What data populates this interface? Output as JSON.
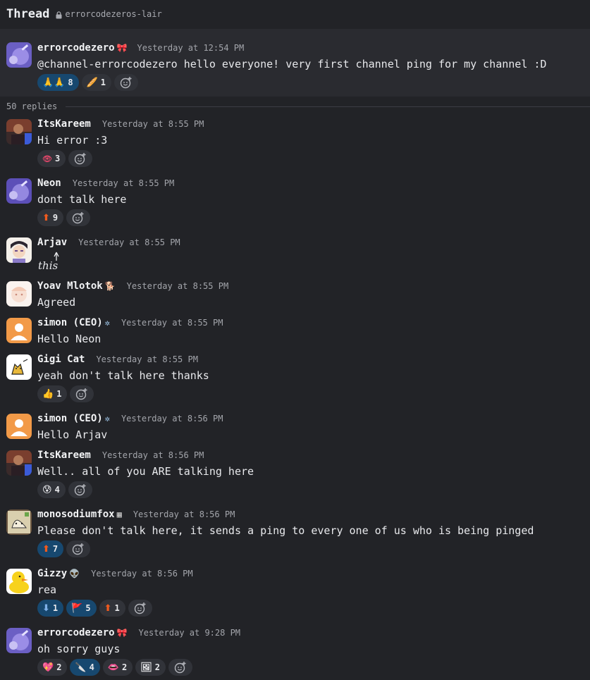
{
  "header": {
    "title": "Thread",
    "channel": "errorcodezeros-lair"
  },
  "root": {
    "author": "errorcodezero",
    "badge": "🎀",
    "time": "Yesterday at 12:54 PM",
    "text": "@channel-errorcodezero hello everyone! very first channel ping for my channel :D",
    "reactions": [
      {
        "emoji": "🙏🙏",
        "count": "8",
        "active": true
      },
      {
        "emoji": "🥖",
        "count": "1",
        "active": false
      }
    ]
  },
  "replies_label": "50 replies",
  "messages": [
    {
      "author": "ItsKareem",
      "badge": "",
      "time": "Yesterday at 8:55 PM",
      "text": "Hi error :3",
      "reactions": [
        {
          "emoji": "👁",
          "count": "3",
          "active": false
        }
      ]
    },
    {
      "author": "Neon",
      "badge": "",
      "time": "Yesterday at 8:55 PM",
      "text": "dont talk here",
      "reactions": [
        {
          "emoji": "⬆",
          "count": "9",
          "active": false
        }
      ]
    },
    {
      "author": "Arjav",
      "badge": "",
      "time": "Yesterday at 8:55 PM",
      "text": "this",
      "reactions": []
    },
    {
      "author": "Yoav Mlotok",
      "badge": "🐕",
      "time": "Yesterday at 8:55 PM",
      "text": "Agreed",
      "reactions": []
    },
    {
      "author": "simon (CEO)",
      "badge": "✲",
      "time": "Yesterday at 8:55 PM",
      "text": "Hello Neon",
      "reactions": []
    },
    {
      "author": "Gigi Cat",
      "badge": "",
      "time": "Yesterday at 8:55 PM",
      "text": "yeah don't talk here thanks",
      "reactions": [
        {
          "emoji": "👍",
          "count": "1",
          "active": false
        }
      ]
    },
    {
      "author": "simon (CEO)",
      "badge": "✲",
      "time": "Yesterday at 8:56 PM",
      "text": "Hello Arjav",
      "reactions": []
    },
    {
      "author": "ItsKareem",
      "badge": "",
      "time": "Yesterday at 8:56 PM",
      "text": "Well.. all of you ARE talking here",
      "reactions": [
        {
          "emoji": "😰",
          "count": "4",
          "active": false
        }
      ]
    },
    {
      "author": "monosodiumfox",
      "badge": "▦",
      "time": "Yesterday at 8:56 PM",
      "text": "Please don't talk here, it sends a ping to every one of us who is being pinged",
      "reactions": [
        {
          "emoji": "⬆",
          "count": "7",
          "active": true
        }
      ]
    },
    {
      "author": "Gizzy",
      "badge": "👽",
      "time": "Yesterday at 8:56 PM",
      "text": "rea",
      "reactions": [
        {
          "emoji": "⬇",
          "count": "1",
          "active": true
        },
        {
          "emoji": "🚩",
          "count": "5",
          "active": true
        },
        {
          "emoji": "⬆",
          "count": "1",
          "active": false
        }
      ]
    },
    {
      "author": "errorcodezero",
      "badge": "🎀",
      "time": "Yesterday at 9:28 PM",
      "text": "oh sorry guys",
      "reactions": [
        {
          "emoji": "💖",
          "count": "2",
          "active": false
        },
        {
          "emoji": "🔪",
          "count": "4",
          "active": true
        },
        {
          "emoji": "👄",
          "count": "2",
          "active": false
        },
        {
          "emoji": "🖼",
          "count": "2",
          "active": false
        }
      ]
    }
  ],
  "colors": {
    "background": "#222327",
    "root_bg": "#2a2b30",
    "reaction_bg": "#313339",
    "reaction_active": "#17486f",
    "time": "#a3a5ab"
  },
  "icons": {
    "lock": "lock-icon",
    "add_reaction": "add-reaction-icon"
  }
}
